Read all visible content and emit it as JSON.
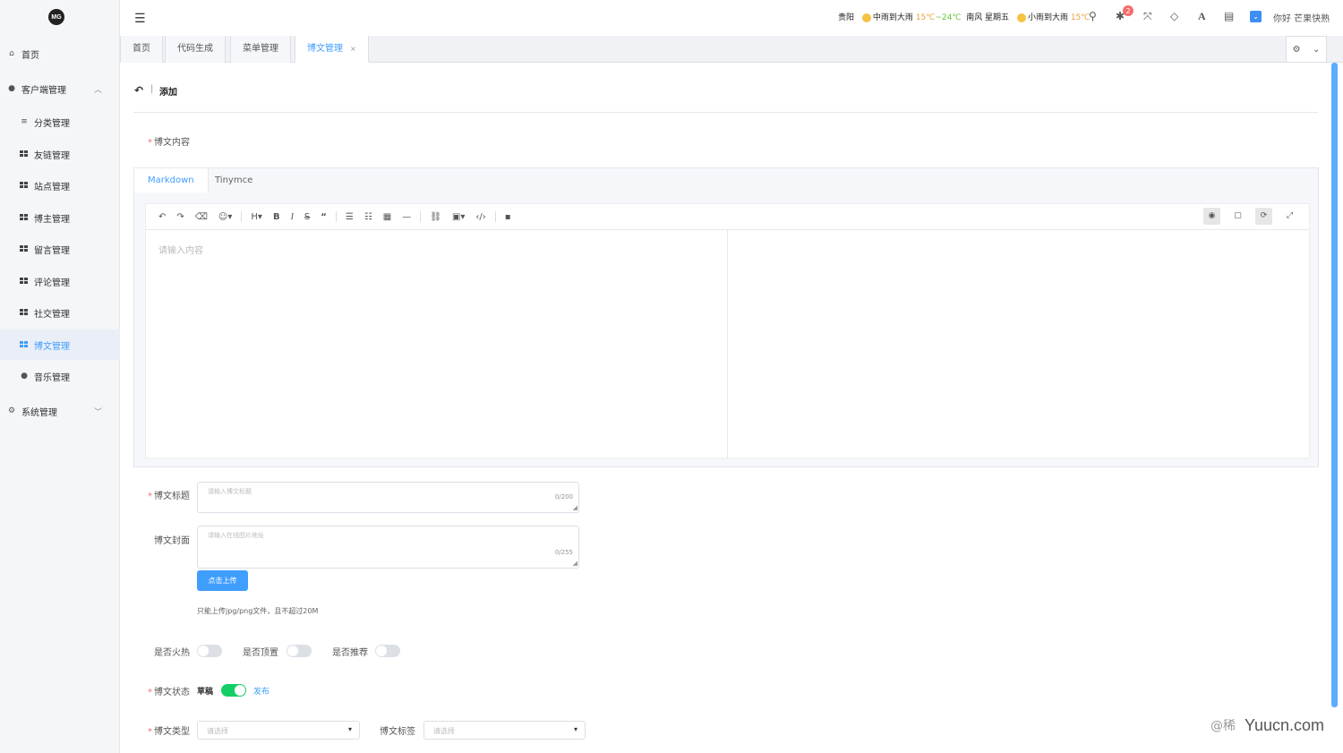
{
  "logo": "MG",
  "sidebar": {
    "items": [
      {
        "label": "首页",
        "icon": "home-icon"
      },
      {
        "label": "客户端管理",
        "icon": "info-circle-icon"
      },
      {
        "label": "分类管理",
        "icon": "list-icon"
      },
      {
        "label": "友链管理",
        "icon": "grid-icon"
      },
      {
        "label": "站点管理",
        "icon": "grid-icon"
      },
      {
        "label": "博主管理",
        "icon": "grid-icon"
      },
      {
        "label": "留言管理",
        "icon": "grid-icon"
      },
      {
        "label": "评论管理",
        "icon": "grid-icon"
      },
      {
        "label": "社交管理",
        "icon": "grid-icon"
      },
      {
        "label": "博文管理",
        "icon": "grid-icon"
      },
      {
        "label": "音乐管理",
        "icon": "circle-icon"
      },
      {
        "label": "系统管理",
        "icon": "gear-icon"
      }
    ]
  },
  "weather": {
    "city": "贵阳",
    "today_desc": "中雨到大雨",
    "today_temp_low": "15℃",
    "today_temp_sep": "~",
    "today_temp_high": "24℃",
    "wind_day": "南风 星期五",
    "tomorrow_desc": "小雨到大雨",
    "tomorrow_temp": "15℃"
  },
  "notifications": {
    "count": "2"
  },
  "header": {
    "user": "你好 芒果快熟",
    "font_icon": "A"
  },
  "tabs": [
    {
      "label": "首页"
    },
    {
      "label": "代码生成"
    },
    {
      "label": "菜单管理"
    },
    {
      "label": "博文管理",
      "close": "×"
    }
  ],
  "page": {
    "back_sep": "|",
    "title": "添加",
    "content_label": "博文内容",
    "editor_tabs": [
      "Markdown",
      "Tinymce"
    ],
    "editor_placeholder": "请输入内容",
    "toolbar": {
      "heading": "H",
      "bold": "B",
      "italic": "I",
      "strike": "S",
      "quote": "“"
    },
    "title_label": "博文标题",
    "title_placeholder": "请输入博文标题",
    "title_count": "0/200",
    "cover_label": "博文封面",
    "cover_placeholder": "请输入在线图片地址",
    "cover_count": "0/255",
    "upload_button": "点击上传",
    "upload_tip": "只能上传jpg/png文件，且不超过20M",
    "hot_label": "是否火热",
    "top_label": "是否顶置",
    "recommend_label": "是否推荐",
    "status_label": "博文状态",
    "status_draft": "草稿",
    "status_publish": "发布",
    "status_on": true,
    "type_label": "博文类型",
    "type_placeholder": "请选择",
    "tag_label": "博文标签",
    "tag_placeholder": "请选择"
  },
  "watermark": {
    "left": "@稀",
    "right": "Yuucn.com"
  },
  "colors": {
    "accent": "#409eff",
    "switch_on": "#13ce66",
    "required": "#f56c6c",
    "sidebar_bg": "#f5f6f8"
  }
}
